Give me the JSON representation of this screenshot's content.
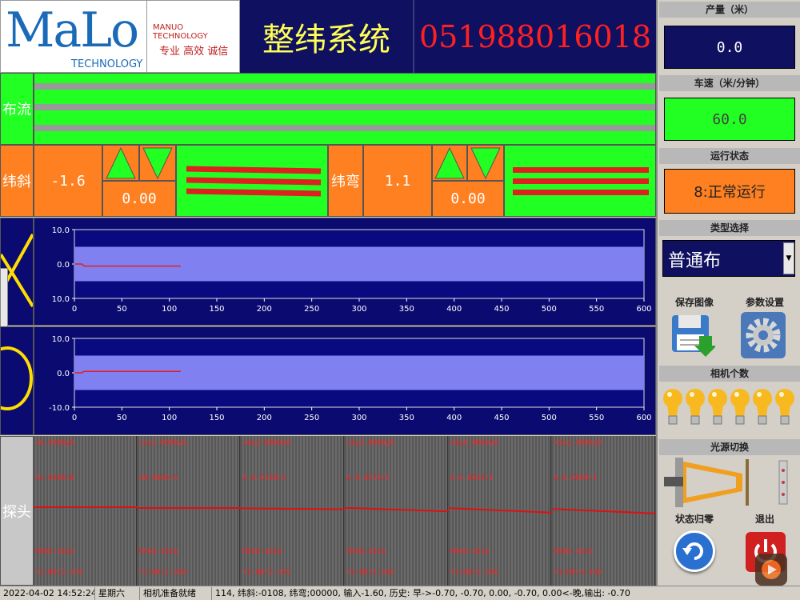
{
  "header": {
    "logo_main": "MaLo",
    "logo_sub": "TECHNOLOGY",
    "logo_company": "MANUO TECHNOLOGY",
    "logo_slogan": "专业 高效 诚信",
    "title": "整纬系统",
    "phone": "051988016018"
  },
  "flow": {
    "label": "布流"
  },
  "skew": {
    "label": "纬斜",
    "value": "-1.6",
    "adjust": "0.00"
  },
  "bow": {
    "label": "纬弯",
    "value": "1.1",
    "adjust": "0.00"
  },
  "charts": {
    "chart1": {
      "ylabels": [
        "10.0",
        "0.0",
        "10.0"
      ],
      "xlabels": [
        "0",
        "50",
        "100",
        "150",
        "200",
        "250",
        "300",
        "350",
        "400",
        "450",
        "500",
        "550",
        "600"
      ]
    },
    "chart2": {
      "ylabels": [
        "10.0",
        "0.0",
        "-10.0"
      ],
      "xlabels": [
        "0",
        "50",
        "100",
        "150",
        "200",
        "250",
        "300",
        "350",
        "400",
        "450",
        "500",
        "550",
        "600"
      ]
    }
  },
  "chart_data": [
    {
      "type": "line",
      "x": [
        0,
        8,
        10,
        112
      ],
      "y": [
        0,
        0,
        -0.6,
        -0.6
      ],
      "band": [
        -5,
        5
      ],
      "xlim": [
        0,
        600
      ],
      "ylim": [
        -10,
        10
      ],
      "ytick_labels": [
        "10.0",
        "0.0",
        "10.0"
      ]
    },
    {
      "type": "line",
      "x": [
        0,
        8,
        10,
        112
      ],
      "y": [
        0,
        0,
        0.4,
        0.4
      ],
      "band": [
        -5,
        5
      ],
      "xlim": [
        0,
        600
      ],
      "ylim": [
        -10,
        10
      ],
      "ytick_labels": [
        "10.0",
        "0.0",
        "-10.0"
      ]
    }
  ],
  "probe": {
    "label": "探头"
  },
  "cameras": [
    {
      "top": "x0.5000y0",
      "a": "A1.0386/N",
      "m": "M500:3616",
      "y": "Y1:N0/2.370"
    },
    {
      "top": "x1y1.0000y0",
      "a": "A0.0000/1",
      "m": "M500:3616",
      "y": "Y1:N0/2.590"
    },
    {
      "top": "x0y2.0000y0",
      "a": "A-0.0198/1",
      "m": "M500:3616",
      "y": "Y1:N0/2.355"
    },
    {
      "top": "x3y3.0000y0",
      "a": "A-0.0270/1",
      "m": "M500:3616",
      "y": "Y1:N0/3.590"
    },
    {
      "top": "x4y4.0000y0",
      "a": "A-0.0033/1",
      "m": "M500:3616",
      "y": "Y1:N0/3.590"
    },
    {
      "top": "x5y5.0000y0",
      "a": "A-0.0050/1",
      "m": "M500:3616",
      "y": "Y1:N0/3.590"
    }
  ],
  "right": {
    "output_label": "产量（米）",
    "output_value": "0.0",
    "speed_label": "车速（米/分钟）",
    "speed_value": "60.0",
    "status_label": "运行状态",
    "status_value": "8:正常运行",
    "type_label": "类型选择",
    "type_value": "普通布",
    "save_label": "保存图像",
    "settings_label": "参数设置",
    "camera_count_label": "相机个数",
    "light_label": "光源切换",
    "reset_label": "状态归零",
    "exit_label": "退出"
  },
  "statusbar": {
    "datetime": "2022-04-02 14:52:24",
    "weekday": "星期六",
    "camera_status": "相机准备就绪",
    "log": "114, 纬斜:-0108, 纬弯;00000, 输入-1.60, 历史: 早->-0.70, -0.70, 0.00, -0.70, 0.00<-晚,输出: -0.70"
  },
  "colors": {
    "orange": "#ff8020",
    "green": "#22ff22",
    "navy": "#101060",
    "red": "#ff2020"
  }
}
